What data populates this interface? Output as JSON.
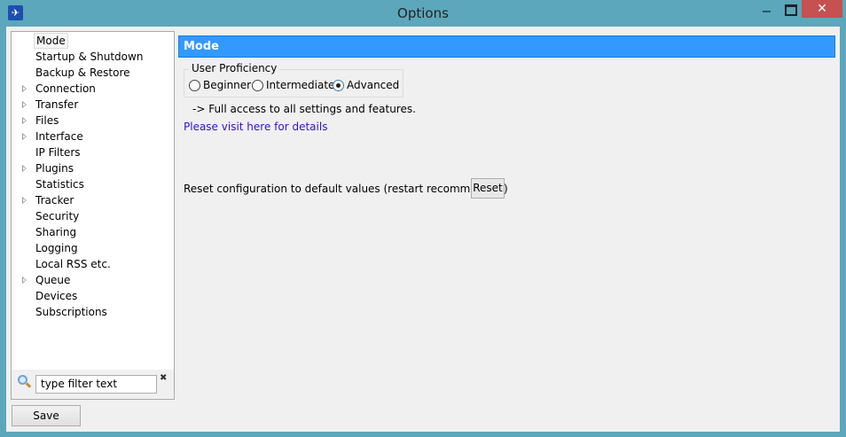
{
  "window": {
    "title": "Options",
    "close": "✕"
  },
  "tree": {
    "items": [
      {
        "label": "Mode",
        "expandable": false,
        "selected": true
      },
      {
        "label": "Startup & Shutdown",
        "expandable": false
      },
      {
        "label": "Backup & Restore",
        "expandable": false
      },
      {
        "label": "Connection",
        "expandable": true
      },
      {
        "label": "Transfer",
        "expandable": true
      },
      {
        "label": "Files",
        "expandable": true
      },
      {
        "label": "Interface",
        "expandable": true
      },
      {
        "label": "IP Filters",
        "expandable": false
      },
      {
        "label": "Plugins",
        "expandable": true
      },
      {
        "label": "Statistics",
        "expandable": false
      },
      {
        "label": "Tracker",
        "expandable": true
      },
      {
        "label": "Security",
        "expandable": false
      },
      {
        "label": "Sharing",
        "expandable": false
      },
      {
        "label": "Logging",
        "expandable": false
      },
      {
        "label": "Local RSS etc.",
        "expandable": false
      },
      {
        "label": "Queue",
        "expandable": true
      },
      {
        "label": "Devices",
        "expandable": false
      },
      {
        "label": "Subscriptions",
        "expandable": false
      }
    ]
  },
  "filter": {
    "value": "type filter text",
    "clear": "✖"
  },
  "save_label": "Save",
  "panel": {
    "title": "Mode",
    "group_label": "User Proficiency",
    "options": [
      {
        "label": "Beginner",
        "checked": false
      },
      {
        "label": "Intermediate",
        "checked": false
      },
      {
        "label": "Advanced",
        "checked": true
      }
    ],
    "description": "-> Full access to all settings and features.",
    "link": "Please visit here for details",
    "reset_text": "Reset configuration to default values (restart recommended)",
    "reset_label": "Reset"
  }
}
